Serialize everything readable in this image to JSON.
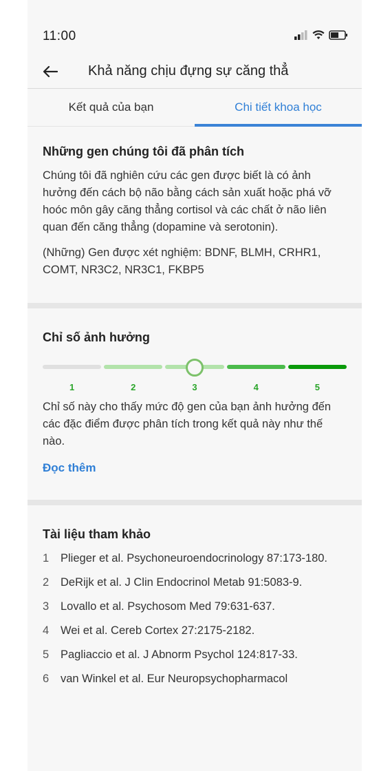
{
  "status_bar": {
    "time": "11:00"
  },
  "header": {
    "title": "Khả năng chịu đựng sự căng thẳ"
  },
  "tabs": [
    {
      "label": "Kết quả của bạn",
      "active": false
    },
    {
      "label": "Chi tiết khoa học",
      "active": true
    }
  ],
  "genes": {
    "title": "Những gen chúng tôi đã phân tích",
    "description": "Chúng tôi đã nghiên cứu các gen được biết là có ảnh hưởng đến cách bộ não bằng cách sản xuất hoặc phá vỡ hoóc môn gây căng thẳng cortisol và các chất ở não liên quan đến căng thẳng (dopamine và serotonin).",
    "tested": "(Những) Gen được xét nghiệm: BDNF, BLMH, CRHR1, COMT, NR3C2, NR3C1, FKBP5"
  },
  "impact": {
    "title": "Chỉ số ảnh hưởng",
    "scale": [
      "1",
      "2",
      "3",
      "4",
      "5"
    ],
    "value": 3,
    "colors": [
      "#e0e0e0",
      "#b3e3ab",
      "#b3e3ab",
      "#4bbb4b",
      "#0a9a0a"
    ],
    "description": "Chỉ số này cho thấy mức độ gen của bạn ảnh hưởng đến các đặc điểm được phân tích trong kết quả này như thế nào.",
    "read_more": "Đọc thêm"
  },
  "references": {
    "title": "Tài liệu tham khảo",
    "items": [
      {
        "num": "1",
        "text": "Plieger et al. Psychoneuroendocrinology 87:173-180."
      },
      {
        "num": "2",
        "text": "DeRijk et al. J Clin Endocrinol Metab 91:5083-9."
      },
      {
        "num": "3",
        "text": "Lovallo et al. Psychosom Med 79:631-637."
      },
      {
        "num": "4",
        "text": "Wei et al. Cereb Cortex 27:2175-2182."
      },
      {
        "num": "5",
        "text": "Pagliaccio et al. J Abnorm Psychol 124:817-33."
      },
      {
        "num": "6",
        "text": "van Winkel et al. Eur Neuropsychopharmacol"
      }
    ]
  },
  "theme": {
    "accent": "#2f7fd6"
  }
}
